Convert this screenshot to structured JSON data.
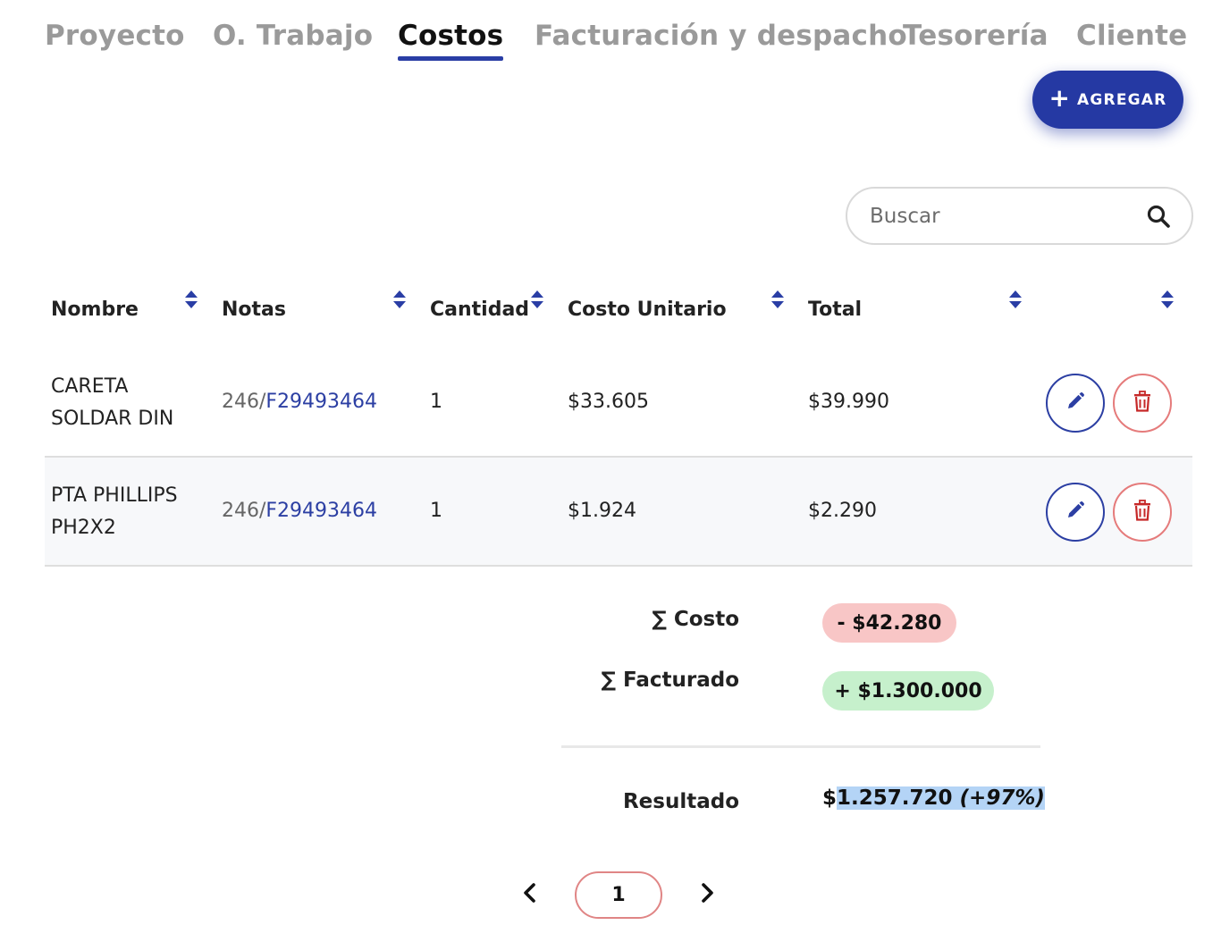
{
  "tabs": [
    {
      "label": "Proyecto",
      "active": false
    },
    {
      "label": "O. Trabajo",
      "active": false
    },
    {
      "label": "Costos",
      "active": true
    },
    {
      "label": "Facturación y despacho",
      "active": false
    },
    {
      "label": "Tesorería",
      "active": false
    },
    {
      "label": "Cliente",
      "active": false
    }
  ],
  "toolbar": {
    "add_label": "AGREGAR",
    "add_icon": "plus-icon"
  },
  "search": {
    "placeholder": "Buscar",
    "value": "",
    "icon": "search-icon"
  },
  "table": {
    "columns": [
      "Nombre",
      "Notas",
      "Cantidad",
      "Costo Unitario",
      "Total",
      ""
    ],
    "rows": [
      {
        "name": "CARETA SOLDAR DIN",
        "notes_prefix": "246/",
        "notes_link": "F29493464",
        "quantity": "1",
        "unit_cost": "$33.605",
        "total": "$39.990"
      },
      {
        "name": "PTA PHILLIPS PH2X2",
        "notes_prefix": "246/",
        "notes_link": "F29493464",
        "quantity": "1",
        "unit_cost": "$1.924",
        "total": "$2.290"
      }
    ]
  },
  "summary": {
    "cost_label": "∑ Costo",
    "cost_value": "- $42.280",
    "billed_label": "∑ Facturado",
    "billed_value": "+ $1.300.000",
    "result_label": "Resultado",
    "result_currency": "$",
    "result_value": "1.257.720",
    "result_percent": "(+97%)"
  },
  "colors": {
    "accent": "#2539a3",
    "danger": "#e57b7b",
    "neg_bg": "#f8c6c6",
    "pos_bg": "#c6f0cc"
  },
  "pagination": {
    "current": "1"
  }
}
